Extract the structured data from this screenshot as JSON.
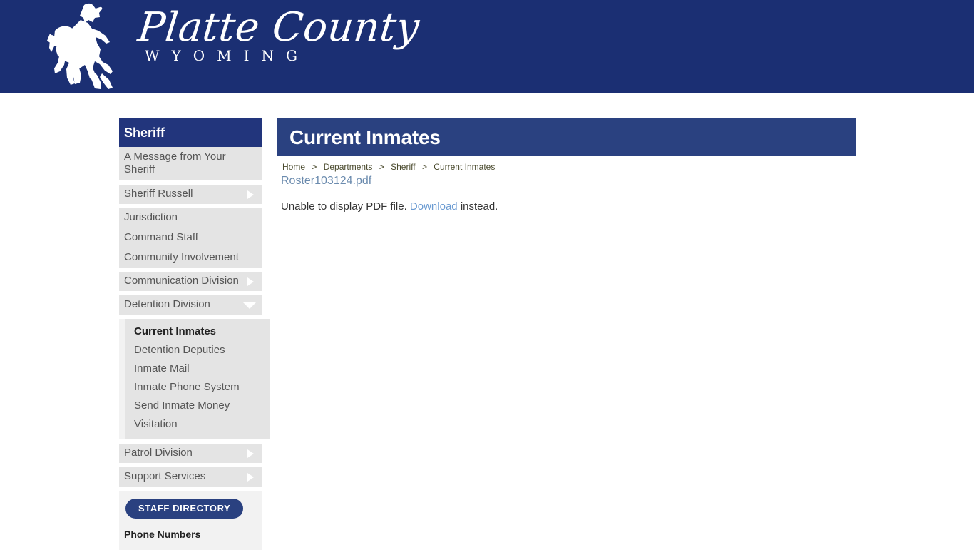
{
  "banner": {
    "logo_script": "Platte County",
    "logo_sub": "WYOMING",
    "emblem_icon": "bucking-horse-icon",
    "background_color": "#1b2f73"
  },
  "sidebar": {
    "header": "Sheriff",
    "items": [
      {
        "label": "A Message from Your Sheriff",
        "arrow": "none",
        "two_line": true
      },
      {
        "label": "Sheriff Russell",
        "arrow": "right",
        "two_line": false
      },
      {
        "label": "Jurisdiction",
        "arrow": "none",
        "two_line": false
      },
      {
        "label": "Command Staff",
        "arrow": "none",
        "two_line": false
      },
      {
        "label": "Community Involvement",
        "arrow": "none",
        "two_line": false
      },
      {
        "label": "Communication Division",
        "arrow": "right",
        "two_line": false
      },
      {
        "label": "Detention Division",
        "arrow": "down",
        "two_line": false
      },
      {
        "label": "Patrol Division",
        "arrow": "right",
        "two_line": false
      },
      {
        "label": "Support Services",
        "arrow": "right",
        "two_line": false
      }
    ],
    "submenu": [
      {
        "label": "Current Inmates",
        "active": true
      },
      {
        "label": "Detention Deputies",
        "active": false
      },
      {
        "label": "Inmate Mail",
        "active": false
      },
      {
        "label": "Inmate Phone System",
        "active": false
      },
      {
        "label": "Send Inmate Money",
        "active": false
      },
      {
        "label": "Visitation",
        "active": false
      }
    ],
    "staff_directory_button": "STAFF DIRECTORY",
    "phone_numbers_heading": "Phone Numbers",
    "header_bg": "#22357c",
    "item_bg": "#e4e4e4"
  },
  "content": {
    "title": "Current Inmates",
    "title_bar_color": "#2a4180",
    "breadcrumb": [
      {
        "label": "Home",
        "link": true
      },
      {
        "label": "Departments",
        "link": true
      },
      {
        "label": "Sheriff",
        "link": true
      },
      {
        "label": "Current Inmates",
        "link": false
      }
    ],
    "breadcrumb_separator": ">",
    "pdf_filename": "Roster103124.pdf",
    "fallback_prefix": "Unable to display PDF file.",
    "fallback_link": "Download",
    "fallback_suffix": "instead.",
    "link_color": "#6b9bd2"
  }
}
